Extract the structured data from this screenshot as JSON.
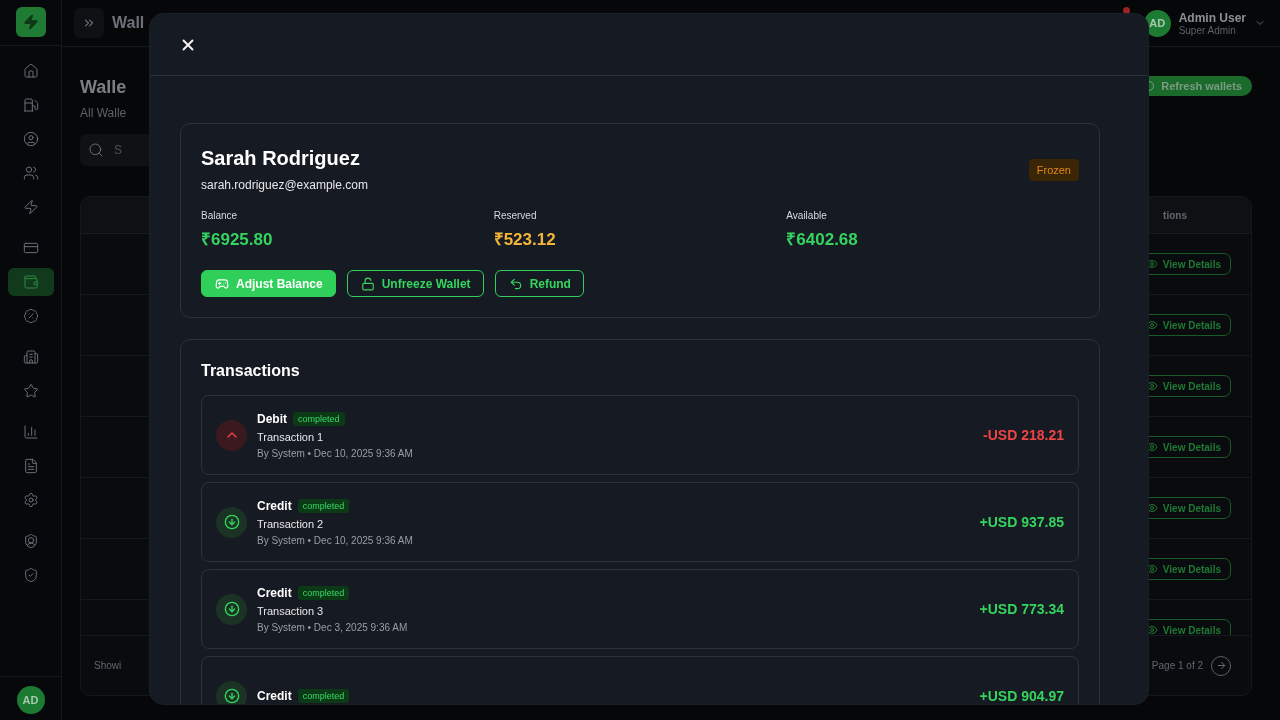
{
  "sidebar": {
    "groups": [
      {
        "items": [
          {
            "selected": false
          },
          {
            "selected": false
          },
          {
            "selected": false
          },
          {
            "selected": false
          },
          {
            "selected": false
          }
        ]
      },
      {
        "items": [
          {
            "selected": false
          },
          {
            "selected": true
          },
          {
            "selected": false
          }
        ]
      },
      {
        "items": [
          {
            "selected": false
          },
          {
            "selected": false
          }
        ]
      },
      {
        "items": [
          {
            "selected": false
          },
          {
            "selected": false
          },
          {
            "selected": false
          }
        ]
      },
      {
        "items": [
          {
            "selected": false
          },
          {
            "selected": false
          }
        ]
      }
    ],
    "avatar": "AD"
  },
  "topbar": {
    "title": "Wall",
    "notification_dot": true,
    "user": {
      "initials": "AD",
      "name": "Admin User",
      "role": "Super Admin"
    }
  },
  "page": {
    "title": "Walle",
    "subtitle": "All Walle",
    "refresh_button": "Refresh wallets",
    "search": {
      "placeholder": "S"
    },
    "table": {
      "header": "tions",
      "rows": [
        {
          "action": "View Details"
        },
        {
          "action": "View Details"
        },
        {
          "action": "View Details"
        },
        {
          "action": "View Details"
        },
        {
          "action": "View Details"
        },
        {
          "action": "View Details"
        },
        {
          "action": "View Details"
        }
      ],
      "summary": "Showi",
      "pagination": "Page 1 of 2"
    }
  },
  "modal": {
    "wallet": {
      "name": "Sarah Rodriguez",
      "email": "sarah.rodriguez@example.com",
      "status": "Frozen",
      "stats": [
        {
          "label": "Balance",
          "value": "₹6925.80",
          "color": "#35d45f"
        },
        {
          "label": "Reserved",
          "value": "₹523.12",
          "color": "#f3b63a"
        },
        {
          "label": "Available",
          "value": "₹6402.68",
          "color": "#35d45f"
        }
      ],
      "actions": [
        {
          "label": "Adjust Balance",
          "kind": "primary"
        },
        {
          "label": "Unfreeze Wallet",
          "kind": "outline"
        },
        {
          "label": "Refund",
          "kind": "outline"
        }
      ]
    },
    "transactions": {
      "title": "Transactions",
      "items": [
        {
          "kind": "debit",
          "type": "Debit",
          "status": "completed",
          "description": "Transaction 1",
          "meta": "By System • Dec 10, 2025 9:36 AM",
          "amount": "-USD 218.21"
        },
        {
          "kind": "credit",
          "type": "Credit",
          "status": "completed",
          "description": "Transaction 2",
          "meta": "By System • Dec 10, 2025 9:36 AM",
          "amount": "+USD 937.85"
        },
        {
          "kind": "credit",
          "type": "Credit",
          "status": "completed",
          "description": "Transaction 3",
          "meta": "By System • Dec 3, 2025 9:36 AM",
          "amount": "+USD 773.34"
        },
        {
          "kind": "credit",
          "type": "Credit",
          "status": "completed",
          "amount": "+USD 904.97"
        }
      ]
    }
  }
}
